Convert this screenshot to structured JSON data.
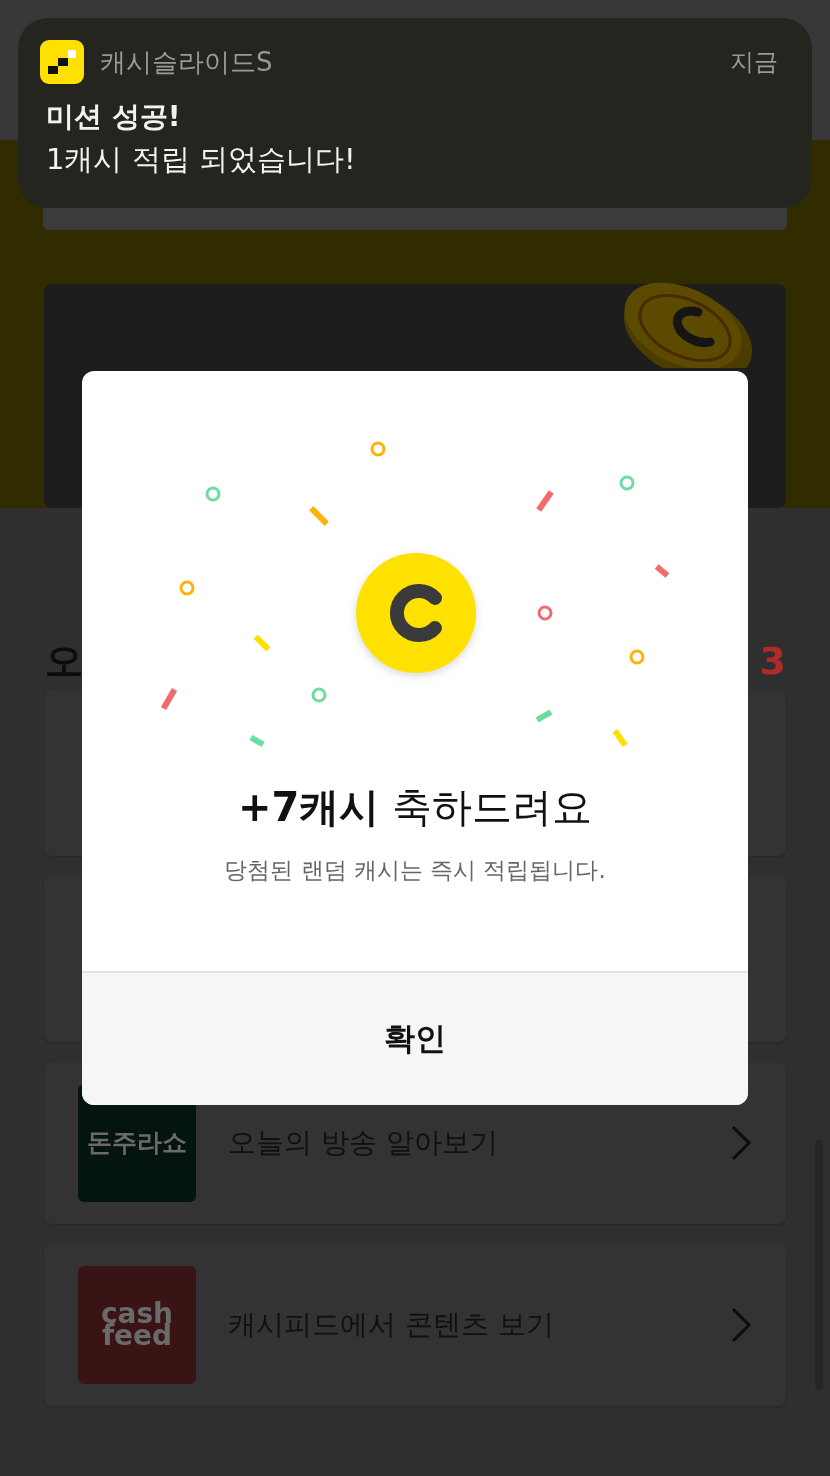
{
  "notification": {
    "app_name": "캐시슬라이드S",
    "time": "지금",
    "title": "미션 성공!",
    "message": "1캐시 적립 되었습니다!"
  },
  "home": {
    "section_title": "오",
    "section_count": "3",
    "cards": [
      {
        "kind": "blank"
      },
      {
        "kind": "blank"
      },
      {
        "kind": "link",
        "logo_text": "돈주라쇼",
        "color": "#04140f",
        "title": "오늘의 방송 알아보기"
      },
      {
        "kind": "link",
        "logo_text": "cash feed",
        "color": "#3a1414",
        "title": "캐시피드에서 콘텐츠 보기"
      }
    ]
  },
  "dialog": {
    "title": "**+7캐시** 축하드려요",
    "subtitle": "당첨된 랜덤 캐시는 즉시 적립됩니다.",
    "button": "확인"
  }
}
